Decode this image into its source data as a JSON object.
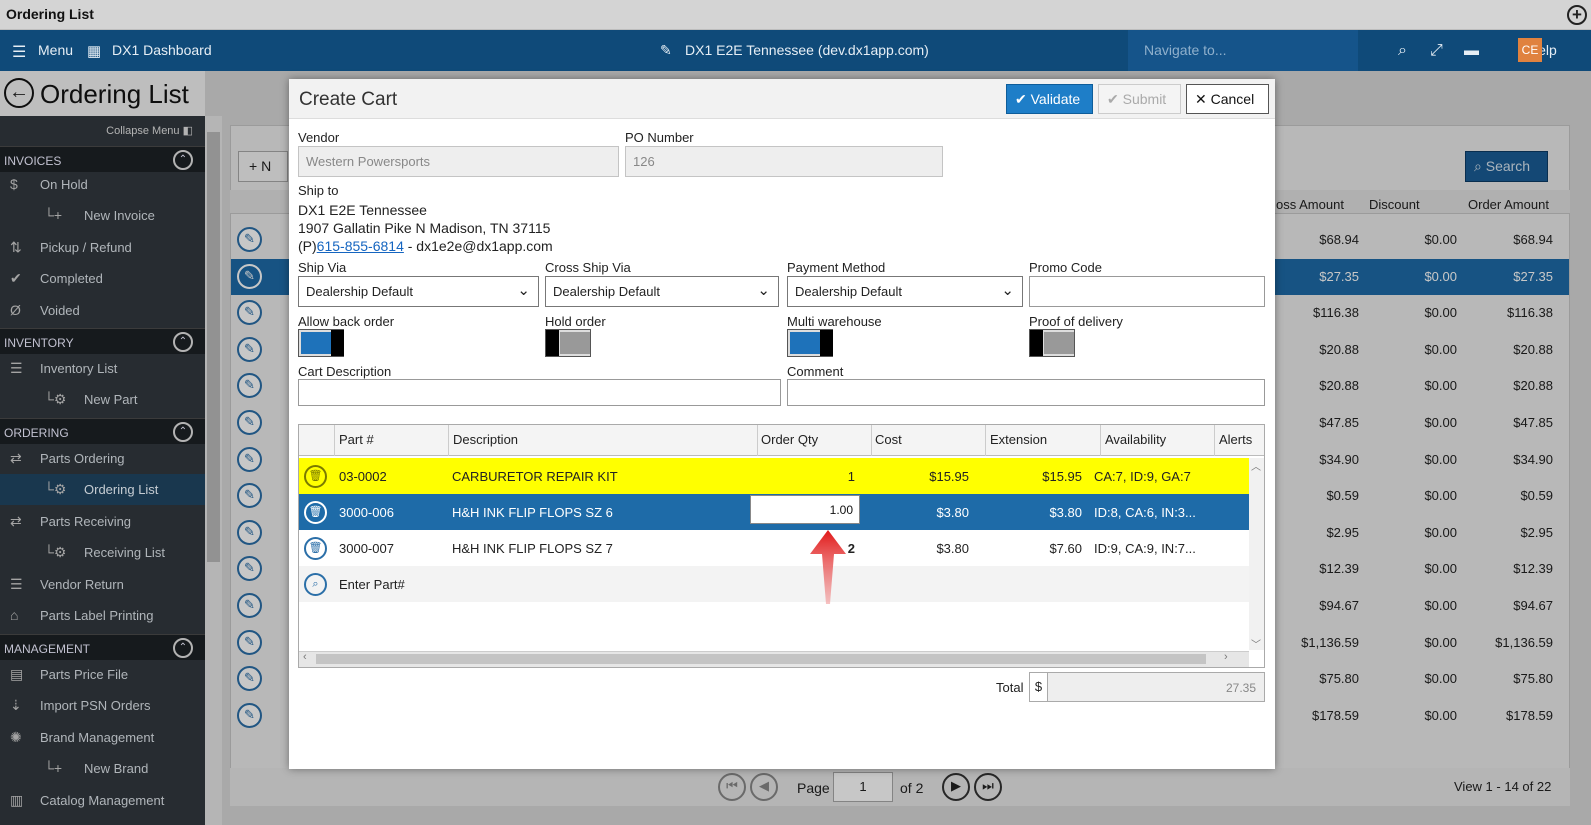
{
  "window": {
    "title": "Ordering List"
  },
  "nav": {
    "menu": "Menu",
    "dashboard": "DX1 Dashboard",
    "site": "DX1 E2E Tennessee (dev.dx1app.com)",
    "search_placeholder": "Navigate to...",
    "user_initials": "CE",
    "help": "Help"
  },
  "page": {
    "title": "Ordering List"
  },
  "sidebar": {
    "collapse": "Collapse Menu",
    "sections": [
      {
        "label": "INVOICES",
        "items": [
          "On Hold",
          "New Invoice",
          "Pickup / Refund",
          "Completed",
          "Voided"
        ]
      },
      {
        "label": "INVENTORY",
        "items": [
          "Inventory List",
          "New Part"
        ]
      },
      {
        "label": "ORDERING",
        "items": [
          "Parts Ordering",
          "Ordering List",
          "Parts Receiving",
          "Receiving List",
          "Vendor Return",
          "Parts Label Printing"
        ]
      },
      {
        "label": "MANAGEMENT",
        "items": [
          "Parts Price File",
          "Import PSN Orders",
          "Brand Management",
          "New Brand",
          "Catalog Management"
        ]
      }
    ]
  },
  "background_table": {
    "search": "Search",
    "new_button_fragment": "+ N",
    "headers": [
      "oss Amount",
      "Discount",
      "Order Amount"
    ],
    "rows": [
      [
        "$68.94",
        "$0.00",
        "$68.94"
      ],
      [
        "$27.35",
        "$0.00",
        "$27.35"
      ],
      [
        "$116.38",
        "$0.00",
        "$116.38"
      ],
      [
        "$20.88",
        "$0.00",
        "$20.88"
      ],
      [
        "$20.88",
        "$0.00",
        "$20.88"
      ],
      [
        "$47.85",
        "$0.00",
        "$47.85"
      ],
      [
        "$34.90",
        "$0.00",
        "$34.90"
      ],
      [
        "$0.59",
        "$0.00",
        "$0.59"
      ],
      [
        "$2.95",
        "$0.00",
        "$2.95"
      ],
      [
        "$12.39",
        "$0.00",
        "$12.39"
      ],
      [
        "$94.67",
        "$0.00",
        "$94.67"
      ],
      [
        "$1,136.59",
        "$0.00",
        "$1,136.59"
      ],
      [
        "$75.80",
        "$0.00",
        "$75.80"
      ],
      [
        "$178.59",
        "$0.00",
        "$178.59"
      ]
    ],
    "pager": {
      "page_label": "Page",
      "page": "1",
      "of": "of 2",
      "view": "View 1 - 14 of 22"
    }
  },
  "modal": {
    "title": "Create Cart",
    "validate": "Validate",
    "submit": "Submit",
    "cancel": "Cancel",
    "vendor_label": "Vendor",
    "vendor": "Western Powersports",
    "po_label": "PO Number",
    "po": "126",
    "ship_to_label": "Ship to",
    "ship_name": "DX1 E2E Tennessee",
    "ship_addr": "1907 Gallatin Pike N Madison, TN 37115",
    "phone_prefix": "(P)",
    "phone": "615-855-6814",
    "email": " - dx1e2e@dx1app.com",
    "ship_via_label": "Ship Via",
    "ship_via": "Dealership Default",
    "cross_ship_label": "Cross Ship Via",
    "cross_ship": "Dealership Default",
    "payment_label": "Payment Method",
    "payment": "Dealership Default",
    "promo_label": "Promo Code",
    "promo": "",
    "allow_back_label": "Allow back order",
    "allow_back_on": true,
    "hold_label": "Hold order",
    "hold_on": false,
    "multi_label": "Multi warehouse",
    "multi_on": true,
    "proof_label": "Proof of delivery",
    "proof_on": false,
    "cart_desc_label": "Cart Description",
    "comment_label": "Comment",
    "grid_headers": [
      "Part #",
      "Description",
      "Order Qty",
      "Cost",
      "Extension",
      "Availability",
      "Alerts"
    ],
    "rows": [
      {
        "part": "03-0002",
        "desc": "CARBURETOR REPAIR KIT",
        "qty": "1",
        "cost": "$15.95",
        "ext": "$15.95",
        "avail": "CA:7, ID:9, GA:7"
      },
      {
        "part": "3000-006",
        "desc": "H&H INK FLIP FLOPS SZ 6",
        "qty": "1.00",
        "cost": "$3.80",
        "ext": "$3.80",
        "avail": "ID:8, CA:6, IN:3..."
      },
      {
        "part": "3000-007",
        "desc": "H&H INK FLIP FLOPS SZ 7",
        "qty": "2",
        "cost": "$3.80",
        "ext": "$7.60",
        "avail": "ID:9, CA:9, IN:7..."
      }
    ],
    "enter_part": "Enter Part#",
    "total_label": "Total",
    "currency": "$",
    "total": "27.35"
  }
}
